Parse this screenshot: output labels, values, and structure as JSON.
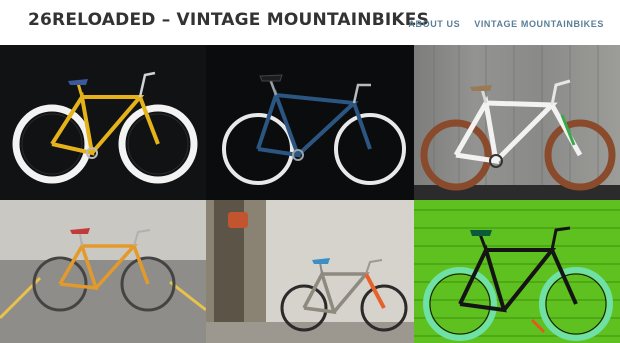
{
  "header": {
    "title": "26RELOADED – VINTAGE MOUNTAINBIKES",
    "nav": [
      {
        "label": "ABOUT US"
      },
      {
        "label": "VINTAGE MOUNTAINBIKES"
      }
    ]
  },
  "gallery": {
    "tiles": [
      {
        "subject": "yellow bike with white rims on black background"
      },
      {
        "subject": "blue bike with white tires on black background"
      },
      {
        "subject": "white bike with brown tires against wooden wall"
      },
      {
        "subject": "orange bike in parking garage"
      },
      {
        "subject": "grey bike with orange fork by concrete pillar"
      },
      {
        "subject": "black bike with green wheels against green wall"
      }
    ]
  }
}
